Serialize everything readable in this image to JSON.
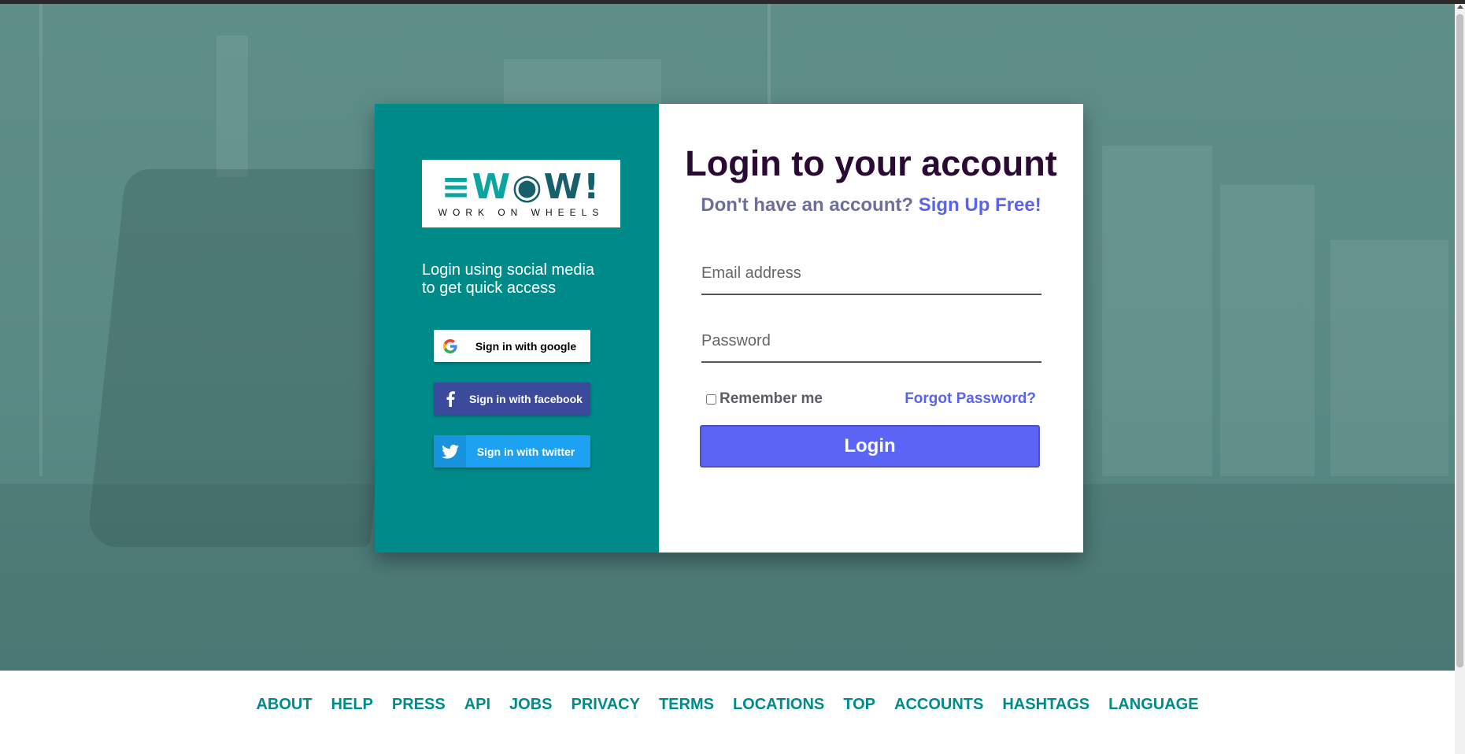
{
  "colors": {
    "hero_bg": "#5a8a84",
    "left_panel": "#008b8b",
    "title": "#2a0a35",
    "link": "#5a63f0",
    "login_button": "#5b64f5",
    "facebook": "#3b4a9a",
    "twitter": "#1da1f2",
    "footer_link": "#008b8b"
  },
  "logo": {
    "mark_a": "≡W",
    "mark_b": "◉W!",
    "sub": "WORK ON WHEELS"
  },
  "social": {
    "prompt": "Login using social media to get quick access",
    "google": {
      "label": "Sign in with google",
      "icon": "google-g-icon"
    },
    "facebook": {
      "label": "Sign in with facebook",
      "icon": "facebook-f-icon"
    },
    "twitter": {
      "label": "Sign in with twitter",
      "icon": "twitter-bird-icon"
    }
  },
  "login": {
    "title": "Login to your account",
    "no_account": "Don't have an account?",
    "signup_link": "Sign Up Free!",
    "email_placeholder": "Email address",
    "password_placeholder": "Password",
    "remember": "Remember me",
    "remember_checked": false,
    "forgot": "Forgot Password?",
    "button": "Login"
  },
  "footer": {
    "links": [
      "ABOUT",
      "HELP",
      "PRESS",
      "API",
      "JOBS",
      "PRIVACY",
      "TERMS",
      "LOCATIONS",
      "TOP",
      "ACCOUNTS",
      "HASHTAGS",
      "LANGUAGE"
    ]
  }
}
